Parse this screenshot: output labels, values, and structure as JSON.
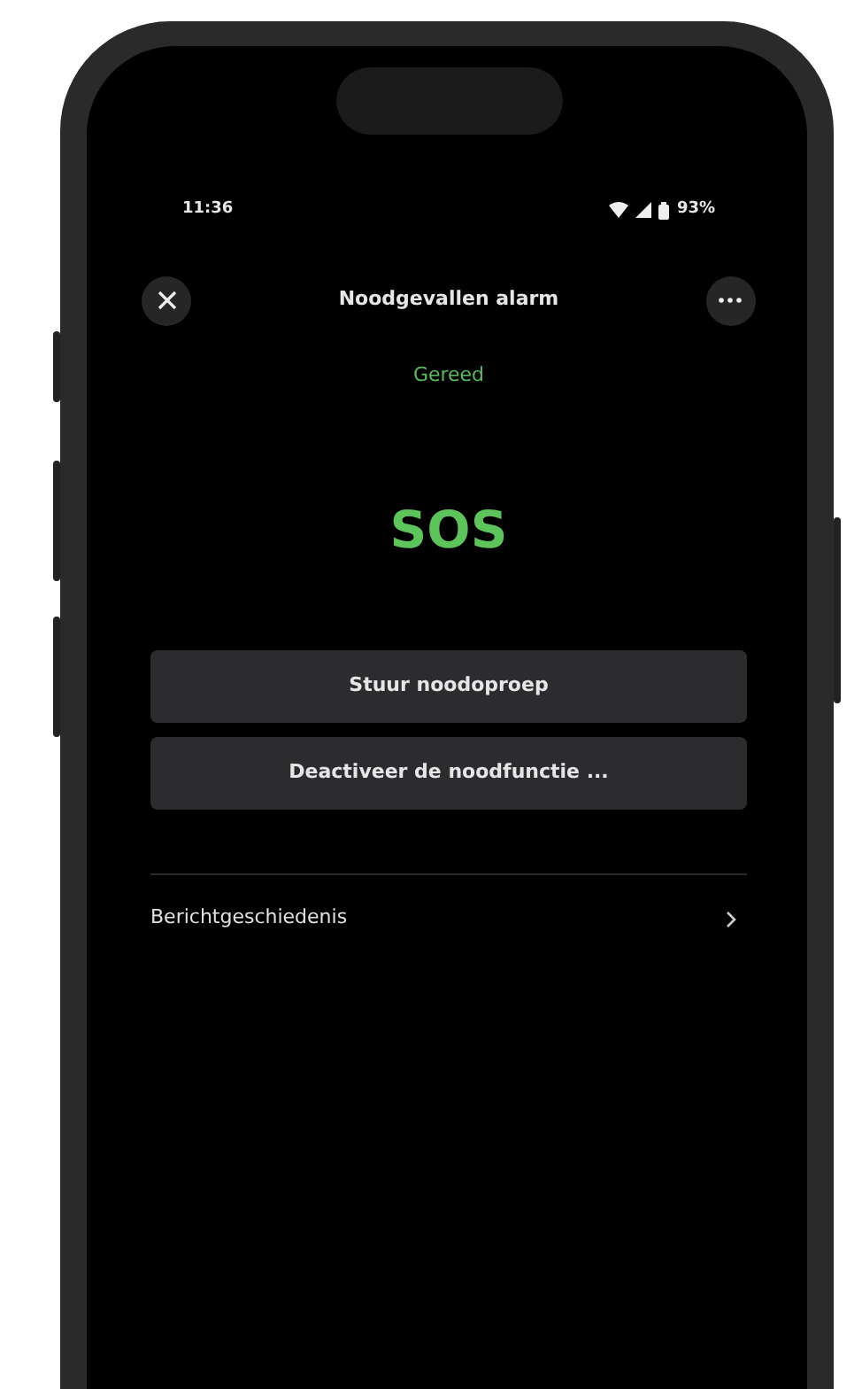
{
  "status_bar": {
    "time": "11:36",
    "battery": "93%"
  },
  "header": {
    "title": "Noodgevallen alarm",
    "status": "Gereed"
  },
  "sos": "SOS",
  "buttons": [
    {
      "label": "Stuur noodoproep"
    },
    {
      "label": "Deactiveer de noodfunctie ..."
    }
  ],
  "list": [
    {
      "label": "Berichtgeschiedenis"
    }
  ]
}
